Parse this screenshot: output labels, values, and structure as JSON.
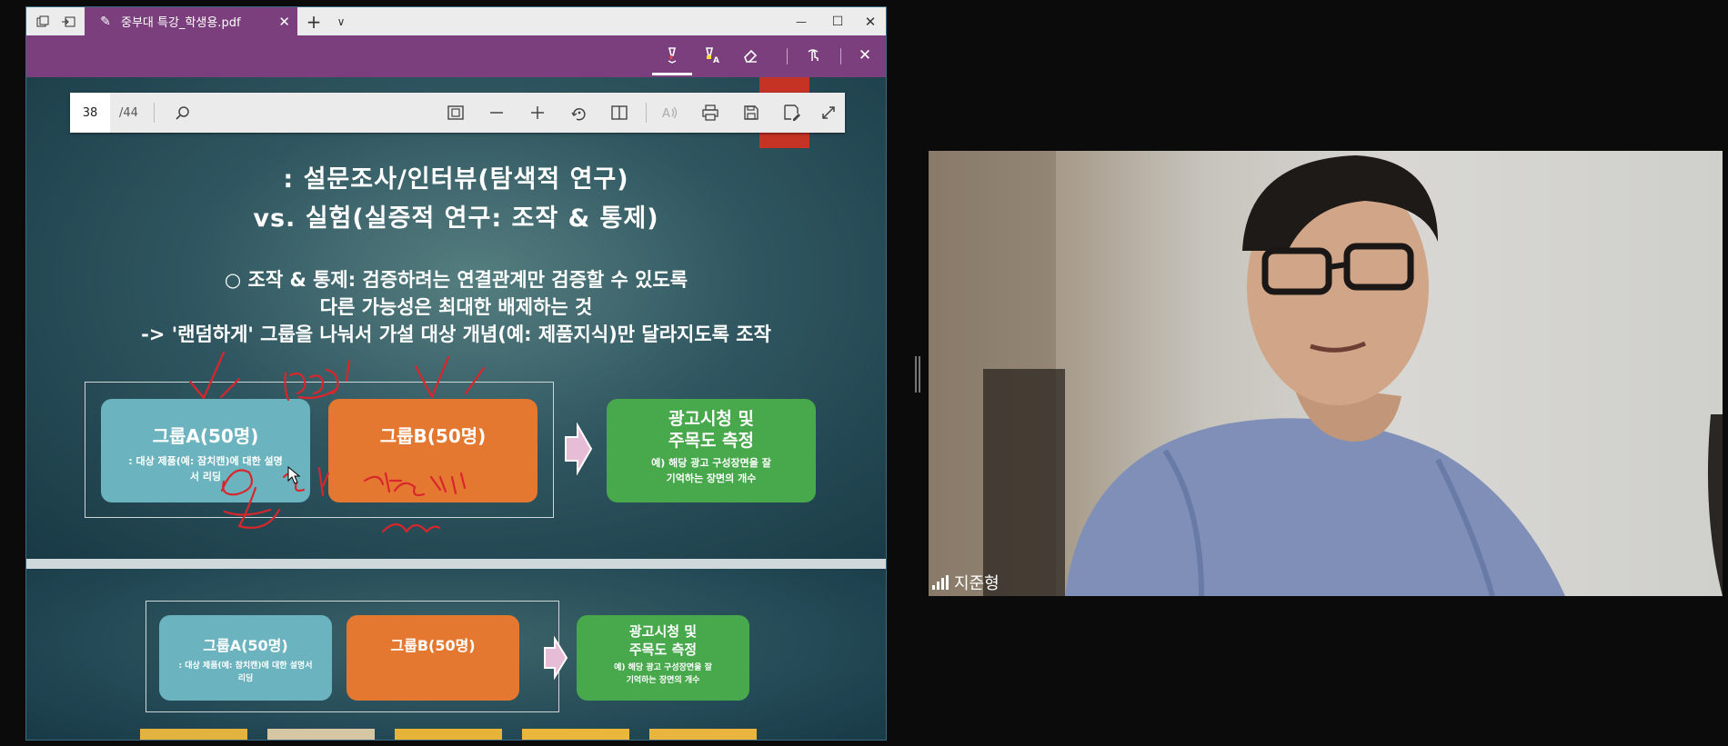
{
  "window": {
    "tab_title": "중부대 특강_학생용.pdf",
    "tab_close": "✕",
    "new_tab": "+",
    "tab_list": "∨",
    "minimize": "—",
    "maximize": "☐",
    "close": "✕"
  },
  "draw_toolbar": {
    "tools": [
      "draw",
      "highlight",
      "erase",
      "touch-writing"
    ],
    "active_tool": "draw",
    "close": "✕"
  },
  "pdf_toolbar": {
    "page_current": "38",
    "page_total": "/44"
  },
  "slide": {
    "heading_line1": ": 설문조사/인터뷰(탐색적 연구)",
    "heading_line2": "vs. 실험(실증적 연구: 조작 & 통제)",
    "body_line1": "○ 조작 & 통제: 검증하려는 연결관계만 검증할 수 있도록",
    "body_line2": "다른 가능성은 최대한 배제하는 것",
    "body_line3": "-> '랜덤하게' 그룹을 나눠서 가설 대상 개념(예: 제품지식)만 달라지도록 조작",
    "group_a_title": "그룹A(50명)",
    "group_a_desc": ": 대상 제품(예: 잠치캔)에 대한 설명서 리딩",
    "group_b_title": "그룹B(50명)",
    "result_title_1": "광고시청 및",
    "result_title_2": "주목도 측정",
    "result_desc_1": "예) 해당 광고 구성장면을 잘",
    "result_desc_2": "기억하는 장면의 개수"
  },
  "slide2": {
    "group_a_title": "그룹A(50명)",
    "group_a_desc": ": 대상 제품(예: 참치캔)에 대한 설명서 리딩",
    "group_b_title": "그룹B(50명)",
    "result_title_1": "광고시청 및",
    "result_title_2": "주목도 측정",
    "result_desc_1": "예) 해당 광고 구성장면을 잘",
    "result_desc_2": "기억하는 장면의 개수"
  },
  "video": {
    "participant_name": "지준형"
  },
  "colors": {
    "tab_purple": "#7b3f7e",
    "group_a": "#6ab3bf",
    "group_b": "#e57830",
    "result": "#48a84c",
    "ink": "#d8262c"
  }
}
